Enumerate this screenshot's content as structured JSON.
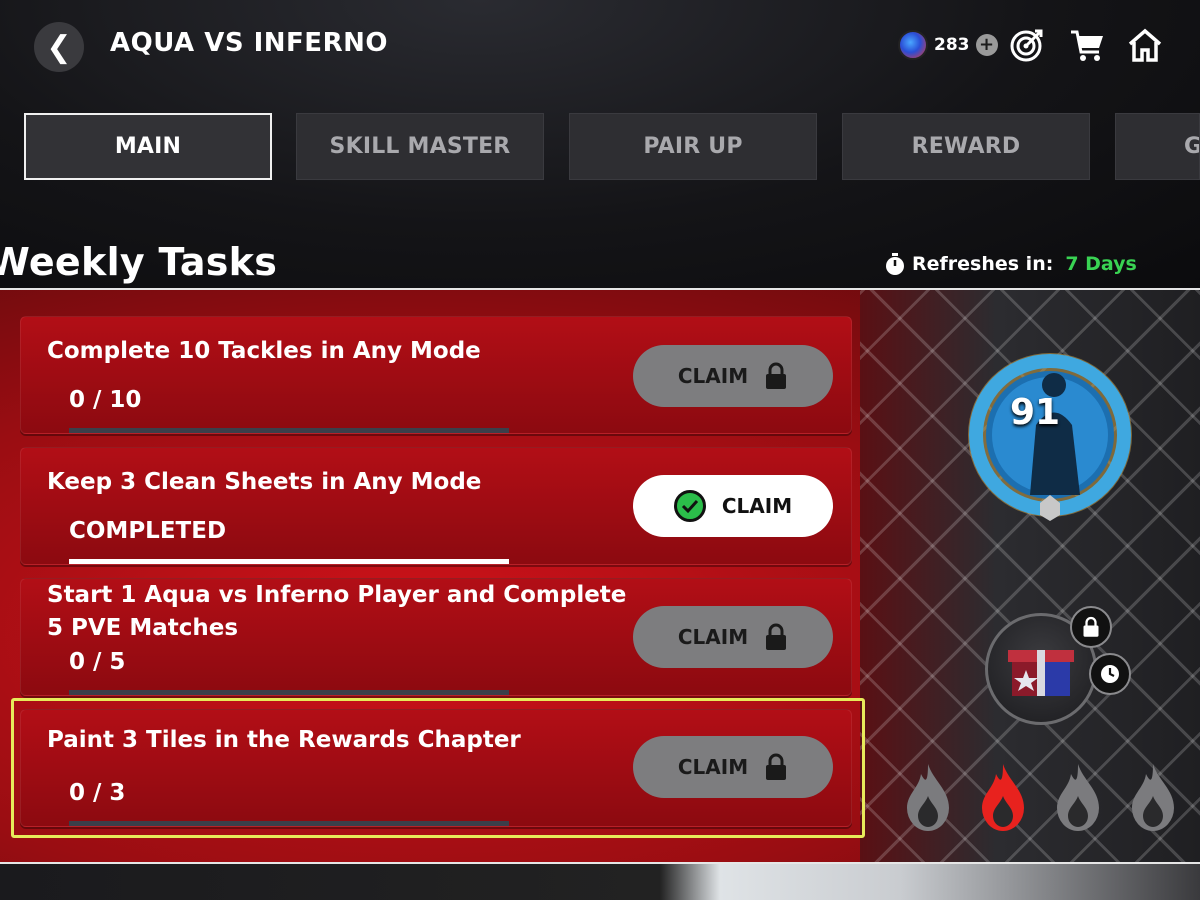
{
  "header": {
    "back_icon": "chevron-left-icon",
    "title": "AQUA VS INFERNO",
    "currency": {
      "icon": "coin-icon",
      "amount": "283",
      "add_icon": "plus-icon"
    },
    "icons": [
      "target-icon",
      "cart-icon",
      "home-icon"
    ]
  },
  "tabs": [
    {
      "label": "MAIN",
      "active": true
    },
    {
      "label": "SKILL MASTER",
      "active": false
    },
    {
      "label": "PAIR UP",
      "active": false
    },
    {
      "label": "REWARD",
      "active": false
    },
    {
      "label": "G",
      "active": false
    }
  ],
  "section": {
    "title": "Weekly Tasks",
    "refresh_label": "Refreshes in:",
    "refresh_value": "7 Days",
    "timer_icon": "stopwatch-icon"
  },
  "tasks": [
    {
      "title": "Complete 10 Tackles in Any Mode",
      "progress": "0 / 10",
      "fraction": 0,
      "claim_label": "CLAIM",
      "state": "locked"
    },
    {
      "title": "Keep 3 Clean Sheets in Any Mode",
      "progress": "COMPLETED",
      "fraction": 1,
      "claim_label": "CLAIM",
      "state": "ready"
    },
    {
      "title": "Start 1 Aqua vs Inferno Player and Complete 5 PVE Matches",
      "progress": "0 / 5",
      "fraction": 0,
      "claim_label": "CLAIM",
      "state": "locked"
    },
    {
      "title": "Paint 3 Tiles in the Rewards Chapter",
      "progress": "0 / 3",
      "fraction": 0,
      "claim_label": "CLAIM",
      "state": "locked"
    }
  ],
  "reward": {
    "player_rating": "91",
    "player_icon": "player-silhouette-icon",
    "gift_icon": "gift-box-icon",
    "gift_lock_icon": "lock-icon",
    "gift_clock_icon": "clock-icon",
    "flames": [
      {
        "icon": "flame-icon",
        "active": false
      },
      {
        "icon": "flame-icon",
        "active": true
      },
      {
        "icon": "flame-icon",
        "active": false
      },
      {
        "icon": "flame-icon",
        "active": false
      }
    ]
  },
  "colors": {
    "accent_red": "#c40f18",
    "refresh_green": "#39d353",
    "highlight_yellow": "#e7ea5a"
  }
}
